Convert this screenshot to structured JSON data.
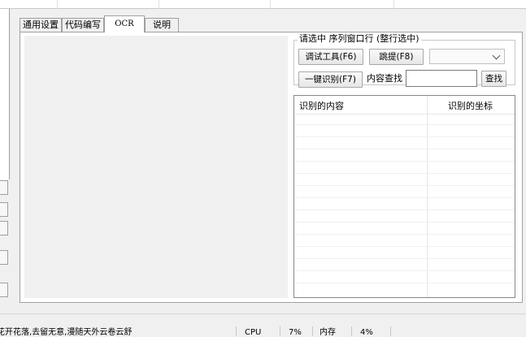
{
  "tabs": [
    {
      "label": "通用设置"
    },
    {
      "label": "代码编写"
    },
    {
      "label": "OCR"
    },
    {
      "label": "说明"
    }
  ],
  "ocr": {
    "group_title": "请选中 序列窗口行 (整行选中)",
    "debug_button": "调试工具(F6)",
    "extract_button": "跳提(F8)",
    "combo_value": "",
    "recognize_button": "一键识别(F7)",
    "search_label": "内容查找",
    "search_value": "",
    "search_button": "查找",
    "columns": [
      "识别的内容",
      "识别的坐标"
    ]
  },
  "status": {
    "motto": "花开花落,去留无意,漫随天外云卷云舒",
    "cpu_label": "CPU",
    "cpu_value": "7%",
    "mem_label": "内存",
    "mem_value": "4%"
  }
}
